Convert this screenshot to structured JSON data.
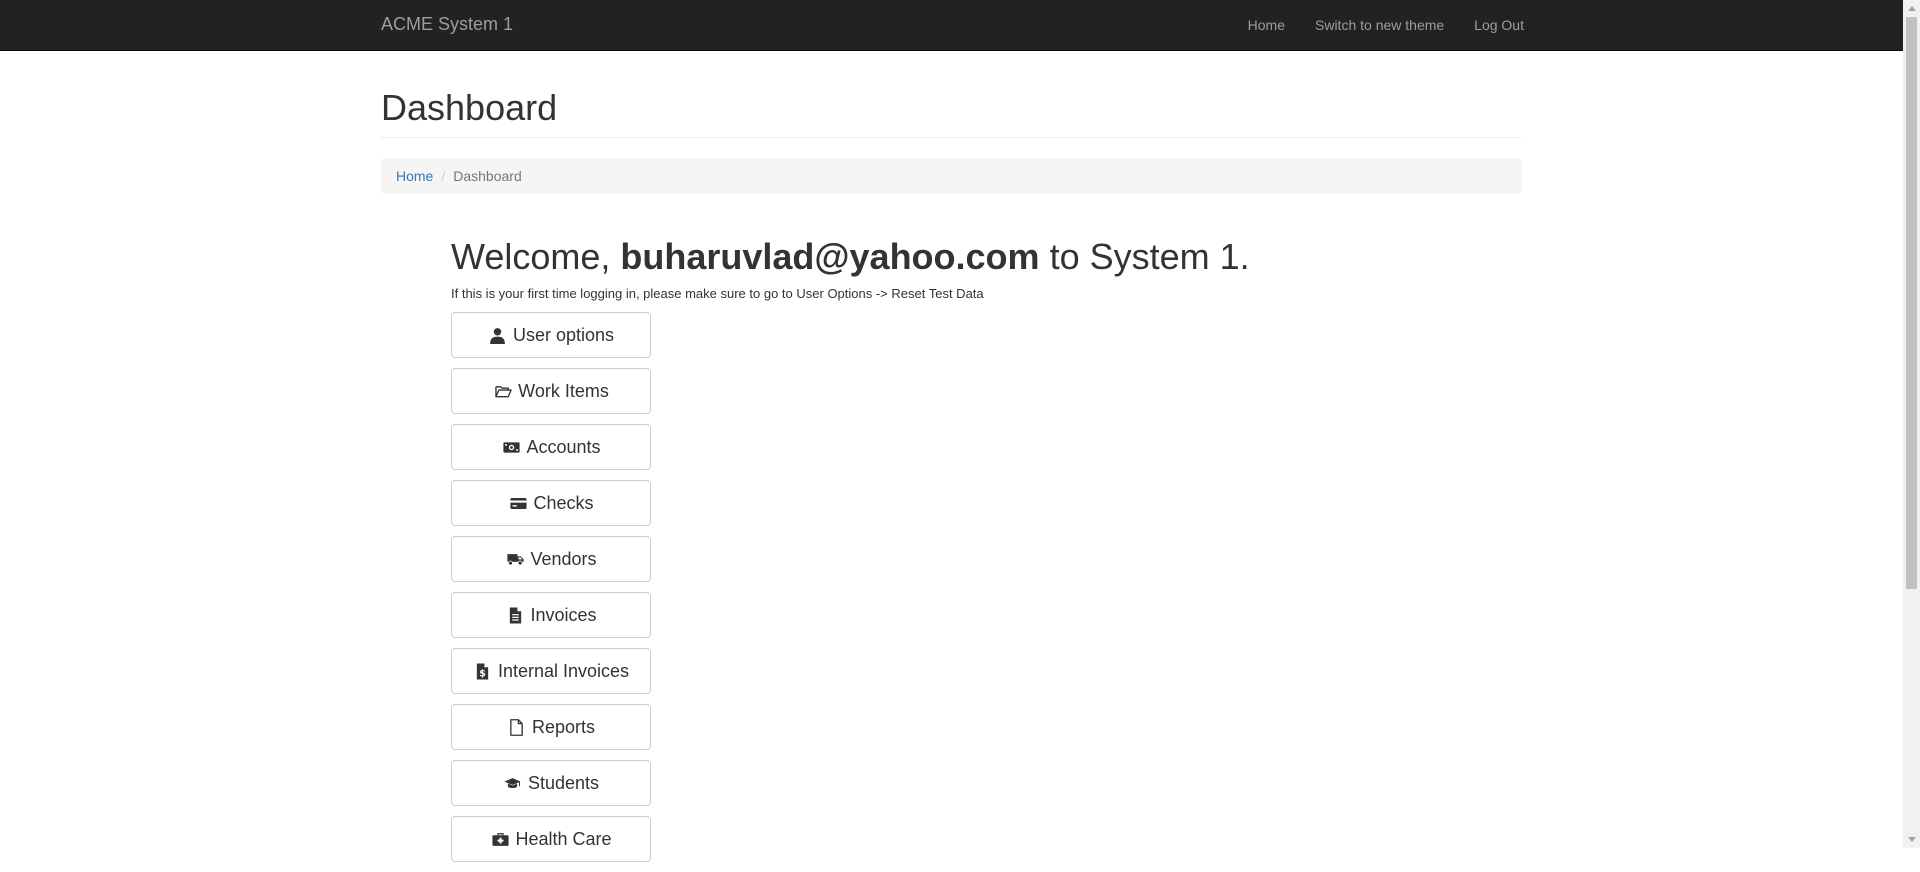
{
  "navbar": {
    "brand": "ACME System 1",
    "links": [
      "Home",
      "Switch to new theme",
      "Log Out"
    ]
  },
  "page": {
    "title": "Dashboard"
  },
  "breadcrumb": {
    "home": "Home",
    "separator": "/",
    "current": "Dashboard"
  },
  "welcome": {
    "prefix": "Welcome, ",
    "user": "buharuvlad@yahoo.com",
    "suffix": " to System 1.",
    "note": "If this is your first time logging in, please make sure to go to User Options -> Reset Test Data"
  },
  "buttons": [
    {
      "label": "User options",
      "icon": "user-icon"
    },
    {
      "label": "Work Items",
      "icon": "folder-open-icon"
    },
    {
      "label": "Accounts",
      "icon": "money-icon"
    },
    {
      "label": "Checks",
      "icon": "credit-card-icon"
    },
    {
      "label": "Vendors",
      "icon": "truck-icon"
    },
    {
      "label": "Invoices",
      "icon": "file-text-icon"
    },
    {
      "label": "Internal Invoices",
      "icon": "file-invoice-dollar-icon"
    },
    {
      "label": "Reports",
      "icon": "file-icon"
    },
    {
      "label": "Students",
      "icon": "graduation-cap-icon"
    },
    {
      "label": "Health Care",
      "icon": "medkit-icon"
    }
  ],
  "colors": {
    "navbar_bg": "#222222",
    "navbar_text": "#9d9d9d",
    "link": "#337ab7",
    "breadcrumb_bg": "#f5f5f5"
  }
}
